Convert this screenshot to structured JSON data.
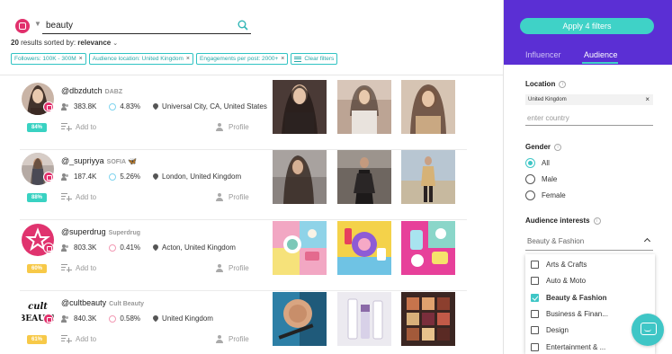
{
  "search": {
    "query": "beauty",
    "results_count": "20",
    "results_text": "results sorted by:",
    "sort_value": "relevance"
  },
  "filters": {
    "chips": [
      "Followers: 100K - 300M",
      "Audience location: United Kingdom",
      "Engagements per post: 2000+"
    ],
    "clear_label": "Clear filters"
  },
  "influencers": [
    {
      "handle": "@dbzdutch",
      "fullname": "DABZ",
      "verified": false,
      "followers": "383.8K",
      "engagement": "4.83%",
      "location": "Universal City, CA, United States",
      "score": "84%",
      "score_color": "green",
      "add_label": "Add to",
      "profile_label": "Profile"
    },
    {
      "handle": "@_supriyya",
      "fullname": "SOFIA",
      "verified": true,
      "followers": "187.4K",
      "engagement": "5.26%",
      "location": "London, United Kingdom",
      "score": "88%",
      "score_color": "green",
      "add_label": "Add to",
      "profile_label": "Profile"
    },
    {
      "handle": "@superdrug",
      "fullname": "Superdrug",
      "verified": false,
      "followers": "803.3K",
      "engagement": "0.41%",
      "location": "Acton, United Kingdom",
      "score": "60%",
      "score_color": "yellow",
      "add_label": "Add to",
      "profile_label": "Profile"
    },
    {
      "handle": "@cultbeauty",
      "fullname": "Cult Beauty",
      "verified": false,
      "followers": "840.3K",
      "engagement": "0.58%",
      "location": "United Kingdom",
      "score": "61%",
      "score_color": "yellow",
      "add_label": "Add to",
      "profile_label": "Profile",
      "logo_text": [
        "cult",
        "BEAUTY"
      ]
    }
  ],
  "panel": {
    "apply_label": "Apply 4 filters",
    "tabs": [
      "Influencer",
      "Audience"
    ],
    "active_tab": "Audience",
    "location_title": "Location",
    "location_chip": "United Kingdom",
    "country_placeholder": "enter country",
    "gender_title": "Gender",
    "gender_options": [
      "All",
      "Male",
      "Female"
    ],
    "gender_selected": "All",
    "interests_title": "Audience interests",
    "interests_selected": "Beauty & Fashion",
    "interest_options": [
      "Arts & Crafts",
      "Auto & Moto",
      "Beauty & Fashion",
      "Business & Finan...",
      "Design",
      "Entertainment & ..."
    ]
  },
  "colors": {
    "accent": "#3fd2c7",
    "header_purple": "#5b2fd4",
    "instagram": "#e1306c",
    "score_green": "#39d2c2",
    "score_yellow": "#f7c948"
  },
  "icons": [
    "instagram-icon",
    "search-icon",
    "users-icon",
    "engagement-icon",
    "location-pin-icon",
    "add-to-list-icon",
    "person-icon",
    "info-icon",
    "chevron-up-icon",
    "chat-icon"
  ]
}
